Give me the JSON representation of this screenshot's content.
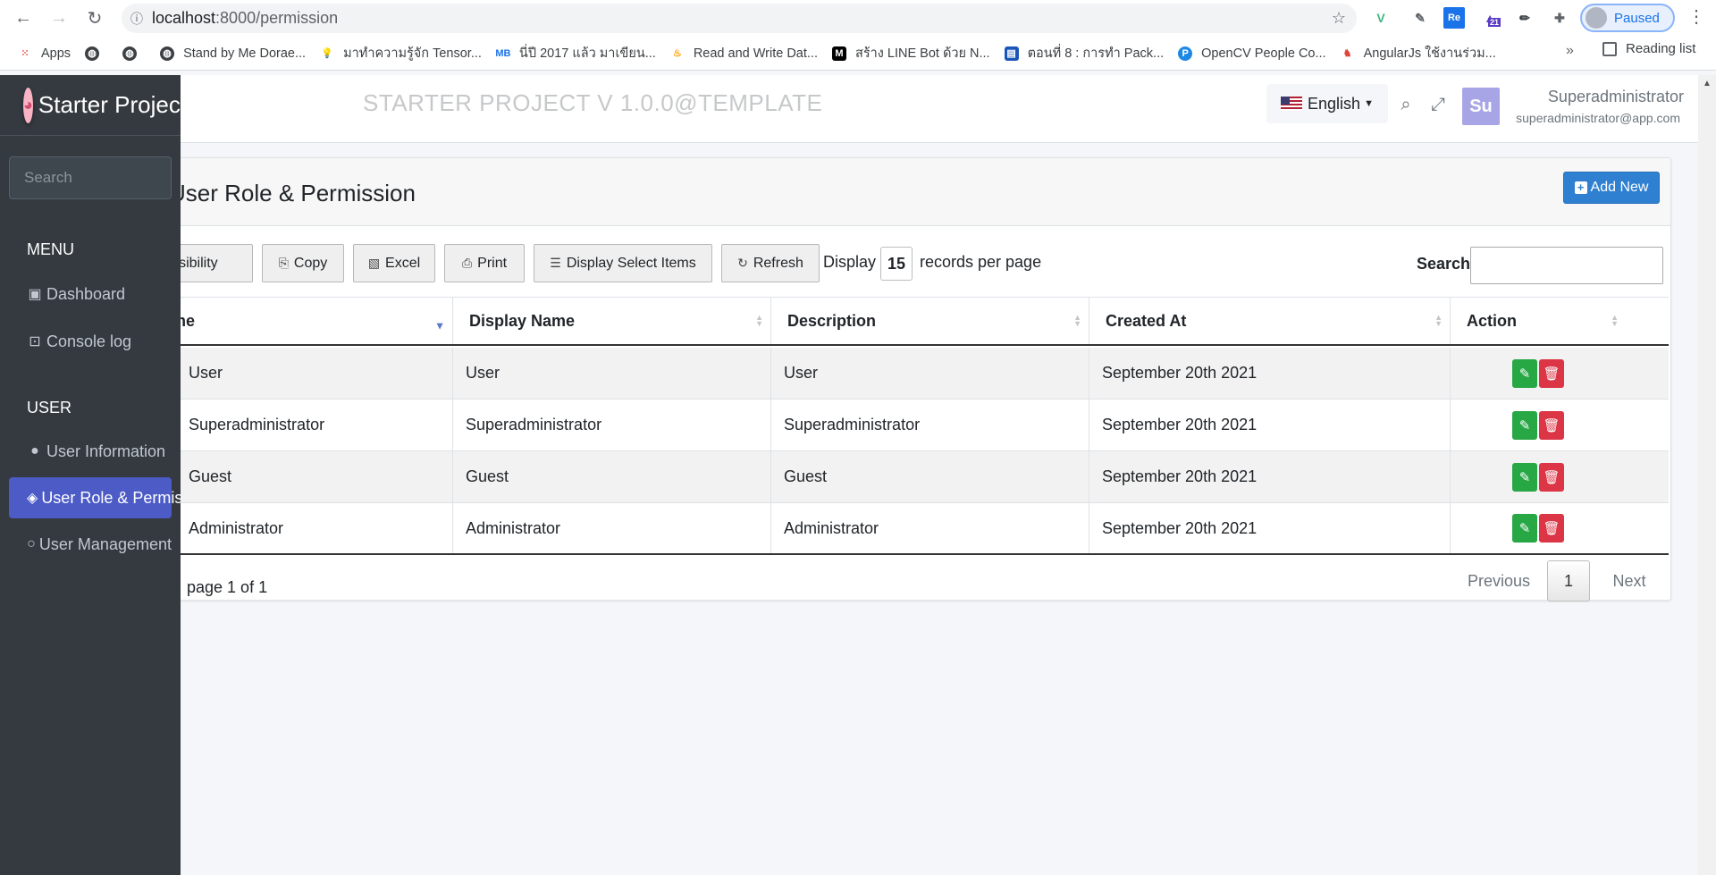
{
  "browser": {
    "url_host": "localhost",
    "url_path": ":8000/permission",
    "profile_label": "Paused",
    "ext_badge": "21"
  },
  "bookmarks": [
    {
      "label": "Apps",
      "icon": "apps-grid-icon"
    },
    {
      "label": "",
      "icon": "globe-icon"
    },
    {
      "label": "",
      "icon": "globe-icon"
    },
    {
      "label": "Stand by Me Dorae...",
      "icon": "globe-icon"
    },
    {
      "label": "มาทำความรู้จัก Tensor...",
      "icon": "bulb-icon"
    },
    {
      "label": "นี่ปี 2017 แล้ว มาเขียน...",
      "icon": "medium-icon"
    },
    {
      "label": "Read and Write Dat...",
      "icon": "fire-icon"
    },
    {
      "label": "สร้าง LINE Bot ด้วย N...",
      "icon": "m-icon"
    },
    {
      "label": "ตอนที่ 8 : การทำ Pack...",
      "icon": "doc-icon"
    },
    {
      "label": "OpenCV People Co...",
      "icon": "p-icon"
    },
    {
      "label": "AngularJs ใช้งานร่วม...",
      "icon": "fox-icon"
    }
  ],
  "reading_list": "Reading list",
  "more_bookmarks": "»",
  "sidebar": {
    "brand": "Starter Project",
    "search_placeholder": "Search",
    "sections": [
      {
        "header": "MENU"
      },
      {
        "header": "USER"
      }
    ],
    "items": [
      {
        "label": "Dashboard",
        "icon": "dashboard-icon"
      },
      {
        "label": "Console log",
        "icon": "terminal-icon"
      },
      {
        "label": "User Information",
        "icon": "user-icon"
      },
      {
        "label": "User Role & Permission",
        "icon": "layers-icon",
        "active": true
      },
      {
        "label": "User Management",
        "icon": "user-outline-icon"
      }
    ]
  },
  "topnav": {
    "title": "STARTER PROJECT V 1.0.0@TEMPLATE",
    "language": "English",
    "avatar_initials": "Su",
    "user_name": "Superadministrator",
    "user_email": "superadministrator@app.com"
  },
  "page": {
    "title": "User Role & Permission",
    "add_new": "Add New"
  },
  "toolbar": {
    "visibility": "visibility",
    "copy": "Copy",
    "excel": "Excel",
    "print": "Print",
    "display_select": "Display Select Items",
    "refresh": "Refresh",
    "display_prefix": "Display",
    "page_size": "15",
    "display_suffix": "records per page",
    "search_label": "Search",
    "search_value": ""
  },
  "table": {
    "columns": [
      "Name",
      "Display Name",
      "Description",
      "Created At",
      "Action"
    ],
    "sorted_column": "Name",
    "rows": [
      [
        "User",
        "User",
        "User",
        "September 20th 2021"
      ],
      [
        "Superadministrator",
        "Superadministrator",
        "Superadministrator",
        "September 20th 2021"
      ],
      [
        "Guest",
        "Guest",
        "Guest",
        "September 20th 2021"
      ],
      [
        "Administrator",
        "Administrator",
        "Administrator",
        "September 20th 2021"
      ]
    ]
  },
  "pagination": {
    "info": "page 1 of 1",
    "previous": "Previous",
    "current": "1",
    "next": "Next"
  },
  "colors": {
    "sidebar_bg": "#343a40",
    "active_item": "#4c5bc6",
    "primary": "#2f80d1",
    "edit": "#28a745",
    "delete": "#dc3545"
  }
}
